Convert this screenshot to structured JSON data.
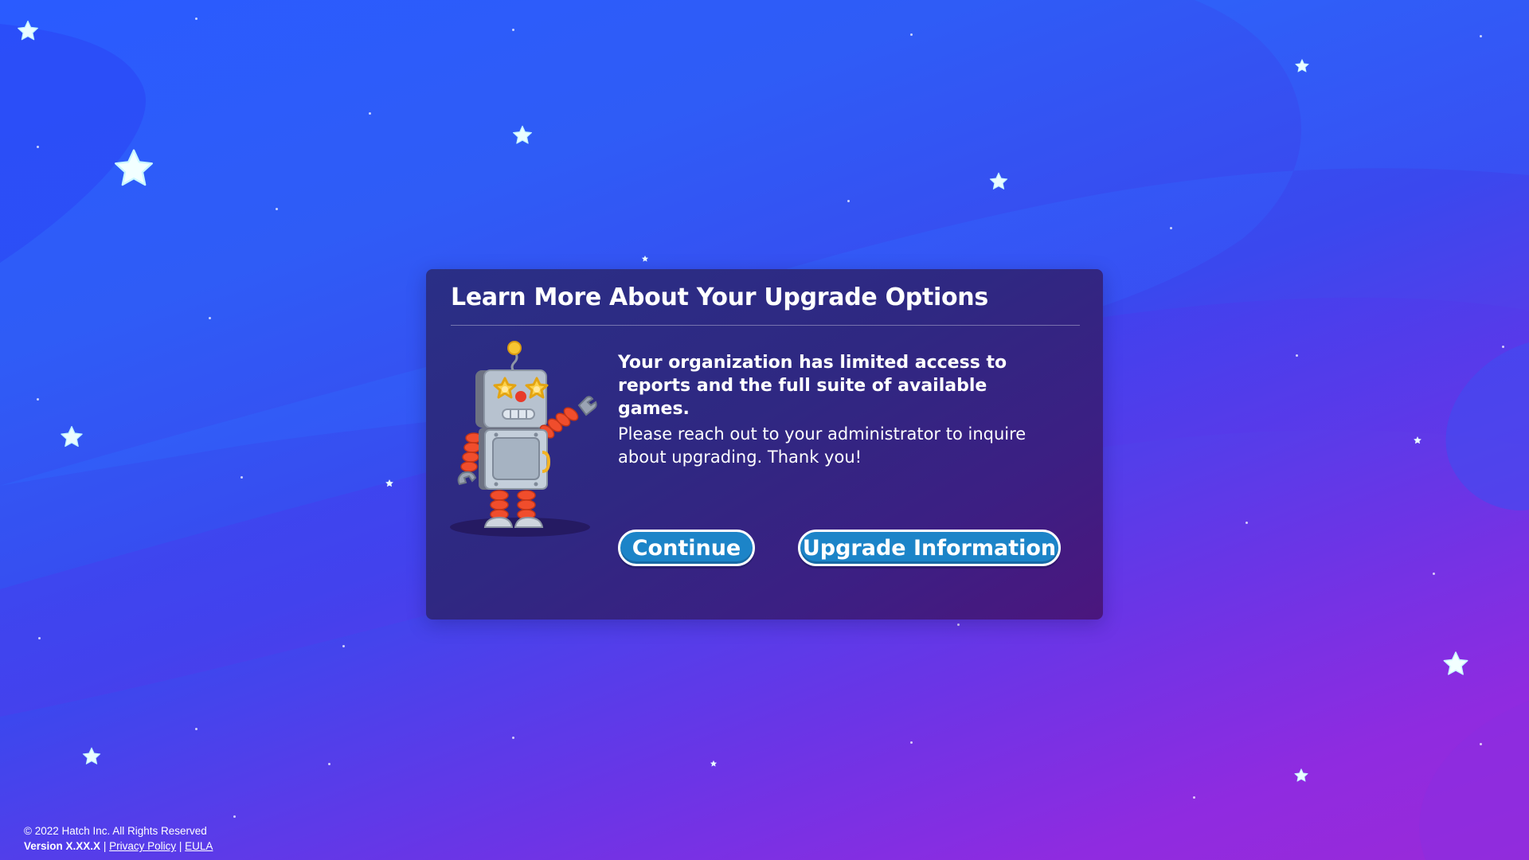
{
  "dialog": {
    "title": "Learn More About Your Upgrade Options",
    "message_strong": "Your organization has limited access to reports and the full suite of available games.",
    "message_body": "Please reach out to your administrator to inquire about upgrading. Thank you!",
    "continue_label": "Continue",
    "upgrade_label": "Upgrade Information",
    "illustration": "robot-mascot"
  },
  "footer": {
    "copyright": "© 2022 Hatch Inc. All Rights Reserved",
    "version": "Version X.XX.X",
    "separator": "|",
    "privacy_label": "Privacy Policy",
    "eula_label": "EULA"
  },
  "colors": {
    "background_top": "#2a5bff",
    "background_bottom": "#9a2ad8",
    "dialog_bg": "#2f2882",
    "button_bg": "#1c84c8",
    "text": "#ffffff"
  },
  "icons": {
    "background_star": "star-icon"
  }
}
